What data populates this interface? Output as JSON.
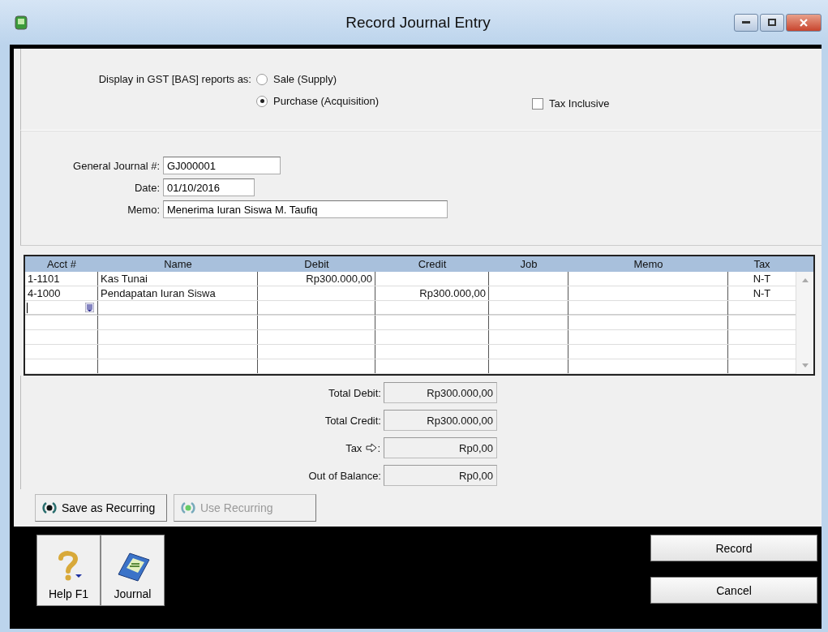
{
  "window": {
    "title": "Record Journal Entry"
  },
  "gst": {
    "label": "Display in GST [BAS] reports as:",
    "options": [
      {
        "label": "Sale (Supply)",
        "selected": false
      },
      {
        "label": "Purchase (Acquisition)",
        "selected": true
      }
    ],
    "tax_inclusive": {
      "label": "Tax Inclusive",
      "checked": false
    }
  },
  "fields": [
    {
      "label": "General Journal #:",
      "value": "GJ000001"
    },
    {
      "label": "Date:",
      "value": "01/10/2016"
    },
    {
      "label": "Memo:",
      "value": "Menerima Iuran Siswa M. Taufiq"
    }
  ],
  "table": {
    "columns": [
      "Acct #",
      "Name",
      "Debit",
      "Credit",
      "Job",
      "Memo",
      "Tax"
    ],
    "rows": [
      {
        "cells": [
          "1-1101",
          "Kas Tunai",
          "Rp300.000,00",
          "",
          "",
          "",
          "N-T"
        ],
        "editing": false
      },
      {
        "cells": [
          "4-1000",
          "Pendapatan Iuran Siswa",
          "",
          "Rp300.000,00",
          "",
          "",
          "N-T"
        ],
        "editing": false
      },
      {
        "cells": [
          "",
          "",
          "",
          "",
          "",
          "",
          ""
        ],
        "editing": true
      }
    ]
  },
  "totals": [
    {
      "label": "Total Debit:",
      "value": "Rp300.000,00",
      "kind": "plain"
    },
    {
      "label": "Total Credit:",
      "value": "Rp300.000,00",
      "kind": "plain"
    },
    {
      "label": "Tax",
      "suffix": ":",
      "value": "Rp0,00",
      "kind": "link"
    },
    {
      "label": "Out of Balance:",
      "value": "Rp0,00",
      "kind": "plain"
    }
  ],
  "recurring_buttons": [
    {
      "label": "Save as Recurring",
      "disabled": false
    },
    {
      "label": "Use Recurring",
      "disabled": true
    }
  ],
  "nav_buttons": [
    {
      "label": "Help F1",
      "kind": "help"
    },
    {
      "label": "Journal",
      "kind": "journal"
    }
  ],
  "actions": [
    "Record",
    "Cancel"
  ]
}
